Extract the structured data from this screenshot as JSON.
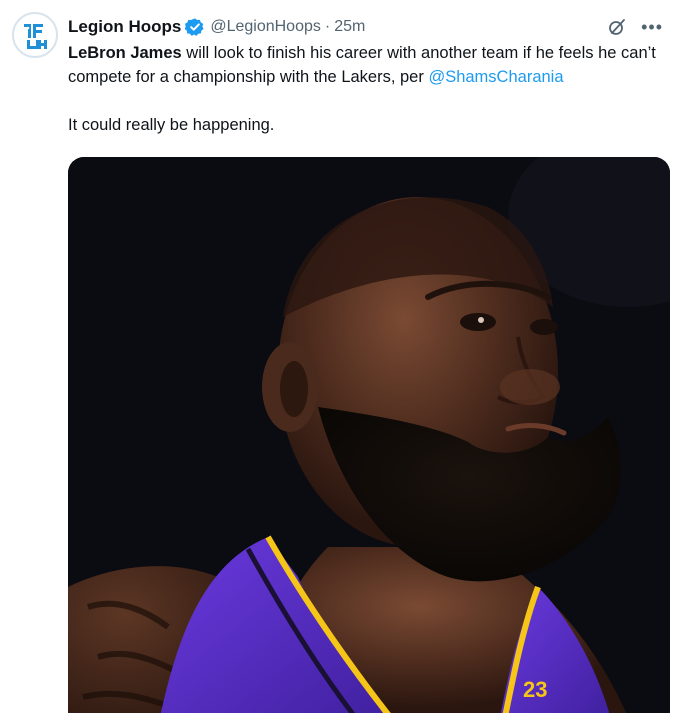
{
  "account": {
    "name": "Legion Hoops",
    "handle": "@LegionHoops",
    "separator": "·",
    "time": "25m",
    "verified_color": "#1d9bf0"
  },
  "tweet": {
    "subject": "LeBron James",
    "body_line": " will look to finish his career with another team if he feels he can’t compete for a championship with the Lakers, per ",
    "mention": "@ShamsCharania",
    "second_paragraph": "It could really be happening."
  },
  "icons": {
    "avatar": "legion-hoops-logo",
    "verified": "verified-badge-icon",
    "grok": "grok-icon",
    "more": "more-options-icon"
  },
  "media": {
    "kind": "photo",
    "jersey_number": "23",
    "jersey_color": "#5a2ec8",
    "trim_color": "#f5c518"
  },
  "colors": {
    "link": "#1d9bf0",
    "secondary_text": "#536471",
    "primary_text": "#0f1419"
  }
}
